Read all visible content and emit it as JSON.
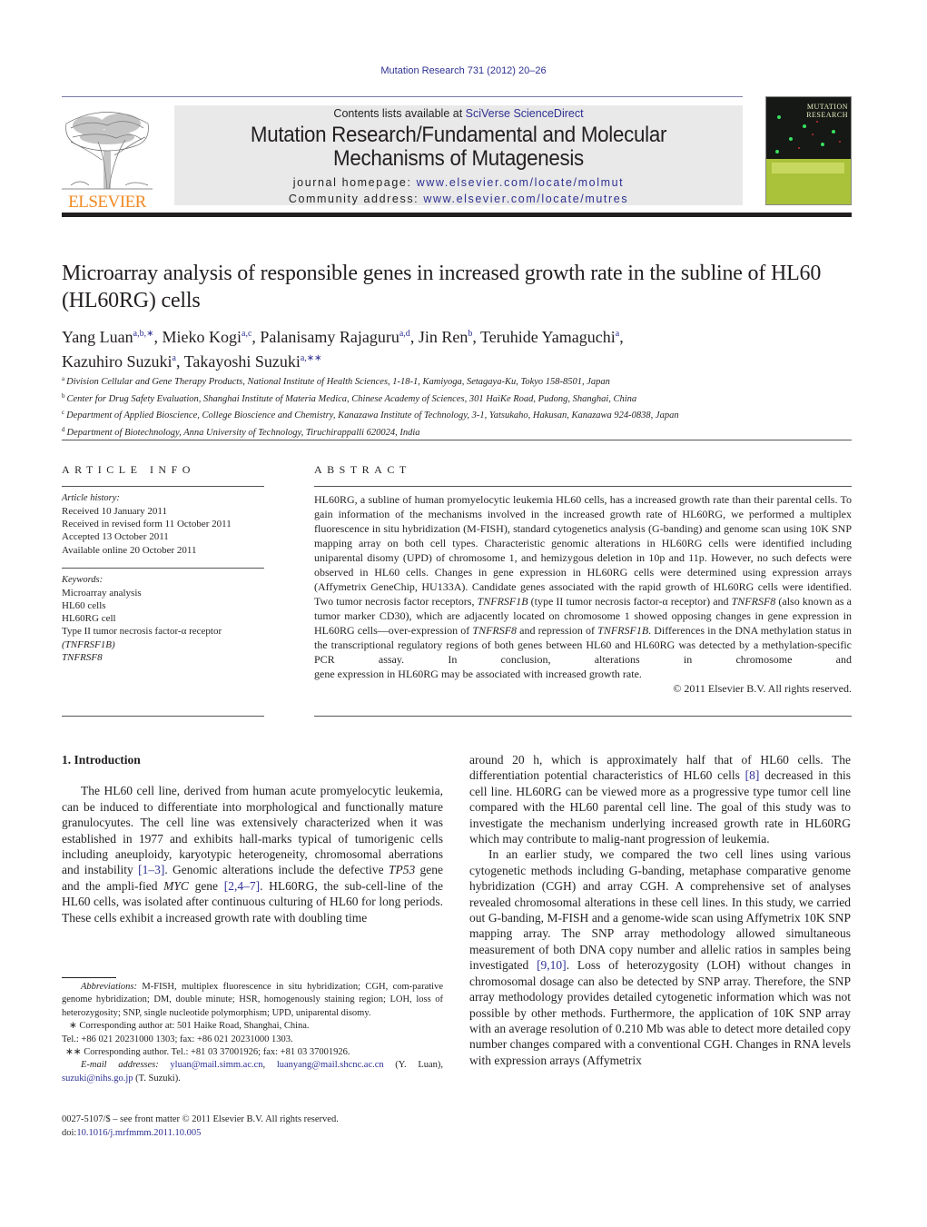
{
  "running_head": "Mutation Research 731 (2012) 20–26",
  "masthead": {
    "publisher": "ELSEVIER",
    "contents_prefix": "Contents lists available at ",
    "contents_link": "SciVerse ScienceDirect",
    "journal_title_line1": "Mutation Research/Fundamental and Molecular",
    "journal_title_line2": "Mechanisms of Mutagenesis",
    "homepage_label": "journal homepage: ",
    "homepage_url": "www.elsevier.com/locate/molmut",
    "community_label": "Community address: ",
    "community_url": "www.elsevier.com/locate/mutres",
    "cover_title_1": "MUTATION",
    "cover_title_2": "RESEARCH"
  },
  "article": {
    "title": "Microarray analysis of responsible genes in increased growth rate in the subline of HL60 (HL60RG) cells",
    "authors": [
      {
        "name": "Yang Luan",
        "sup": "a,b,∗",
        "sep": ", "
      },
      {
        "name": "Mieko Kogi",
        "sup": "a,c",
        "sep": ", "
      },
      {
        "name": "Palanisamy Rajaguru",
        "sup": "a,d",
        "sep": ", "
      },
      {
        "name": "Jin Ren",
        "sup": "b",
        "sep": ", "
      },
      {
        "name": "Teruhide Yamaguchi",
        "sup": "a",
        "sep": ","
      },
      {
        "name": "Kazuhiro Suzuki",
        "sup": "a",
        "sep": ", "
      },
      {
        "name": "Takayoshi Suzuki",
        "sup": "a,∗∗",
        "sep": ""
      }
    ],
    "affiliations": [
      {
        "key": "a",
        "text": "Division Cellular and Gene Therapy Products, National Institute of Health Sciences, 1-18-1, Kamiyoga, Setagaya-Ku, Tokyo 158-8501, Japan"
      },
      {
        "key": "b",
        "text": "Center for Drug Safety Evaluation, Shanghai Institute of Materia Medica, Chinese Academy of Sciences, 301 HaiKe Road, Pudong, Shanghai, China"
      },
      {
        "key": "c",
        "text": "Department of Applied Bioscience, College Bioscience and Chemistry, Kanazawa Institute of Technology, 3-1, Yatsukaho, Hakusan, Kanazawa 924-0838, Japan"
      },
      {
        "key": "d",
        "text": "Department of Biotechnology, Anna University of Technology, Tiruchirappalli 620024, India"
      }
    ]
  },
  "article_info": {
    "heading": "ARTICLE INFO",
    "history_label": "Article history:",
    "history": [
      "Received 10 January 2011",
      "Received in revised form 11 October 2011",
      "Accepted 13 October 2011",
      "Available online 20 October 2011"
    ],
    "keywords_label": "Keywords:",
    "keywords": [
      "Microarray analysis",
      "HL60 cells",
      "HL60RG cell",
      "Type II tumor necrosis factor-α receptor",
      "(TNFRSF1B)",
      "TNFRSF8"
    ]
  },
  "abstract": {
    "heading": "ABSTRACT",
    "text": "HL60RG, a subline of human promyelocytic leukemia HL60 cells, has a increased growth rate than their parental cells. To gain information of the mechanisms involved in the increased growth rate of HL60RG, we performed a multiplex fluorescence in situ hybridization (M-FISH), standard cytogenetics analysis (G-banding) and genome scan using 10K SNP mapping array on both cell types. Characteristic genomic alterations in HL60RG cells were identified including uniparental disomy (UPD) of chromosome 1, and hemizygous deletion in 10p and 11p. However, no such defects were observed in HL60 cells. Changes in gene expression in HL60RG cells were determined using expression arrays (Affymetrix GeneChip, HU133A). Candidate genes associated with the rapid growth of HL60RG cells were identified. Two tumor necrosis factor receptors, TNFRSF1B (type II tumor necrosis factor-α receptor) and TNFRSF8 (also known as a tumor marker CD30), which are adjacently located on chromosome 1 showed opposing changes in gene expression in HL60RG cells—over-expression of TNFRSF8 and repression of TNFRSF1B. Differences in the DNA methylation status in the transcriptional regulatory regions of both genes between HL60 and HL60RG was detected by a methylation-specific PCR assay. In conclusion, alterations in chromosome and",
    "last_line": "gene expression in HL60RG may be associated with increased growth rate.",
    "copyright": "© 2011 Elsevier B.V. All rights reserved."
  },
  "body": {
    "section_heading": "1.  Introduction",
    "left_para": [
      {
        "t": "The HL60 cell line, derived from human acute promyelocytic leukemia, can be induced to differentiate into morphological and functionally mature granulocyutes. The cell line was extensively characterized when it was established in 1977 and exhibits hall-marks typical of tumorigenic cells including aneuploidy, karyotypic heterogeneity, chromosomal aberrations and instability "
      },
      {
        "ref": "[1–3]"
      },
      {
        "t": ". Genomic alterations include the defective "
      },
      {
        "i": "TP53"
      },
      {
        "t": " gene and the ampli-fied "
      },
      {
        "i": "MYC"
      },
      {
        "t": " gene "
      },
      {
        "ref": "[2,4–7]"
      },
      {
        "t": ". HL60RG, the sub-cell-line of the HL60 cells, was isolated after continuous culturing of HL60 for long periods. These cells exhibit a increased growth rate with doubling time"
      }
    ],
    "right_para1": [
      {
        "t": "around 20 h, which is approximately half that of HL60 cells. The differentiation potential characteristics of HL60 cells "
      },
      {
        "ref": "[8]"
      },
      {
        "t": " decreased in this cell line. HL60RG can be viewed more as a progressive type tumor cell line compared with the HL60 parental cell line. The goal of this study was to investigate the mechanism underlying increased growth rate in HL60RG which may contribute to malig-nant progression of leukemia."
      }
    ],
    "right_para2": [
      {
        "t": "In an earlier study, we compared the two cell lines using various cytogenetic methods including G-banding, metaphase comparative genome hybridization (CGH) and array CGH. A comprehensive set of analyses revealed chromosomal alterations in these cell lines. In this study, we carried out G-banding, M-FISH and a genome-wide scan using Affymetrix 10K SNP mapping array. The SNP array methodology allowed simultaneous measurement of both DNA copy number and allelic ratios in samples being investigated "
      },
      {
        "ref": "[9,10]"
      },
      {
        "t": ". Loss of heterozygosity (LOH) without changes in chromosomal dosage can also be detected by SNP array. Therefore, the SNP array methodology provides detailed cytogenetic information which was not possible by other methods. Furthermore, the application of 10K SNP array with an average resolution of 0.210 Mb was able to detect more detailed copy number changes compared with a conventional CGH. Changes in RNA levels with expression arrays (Affymetrix"
      }
    ]
  },
  "footnotes": {
    "abbrev_label": "Abbreviations:",
    "abbrev_text": " M-FISH, multiplex fluorescence in situ hybridization; CGH, com-parative genome hybridization; DM, double minute; HSR, homogenously staining region; LOH, loss of heterozygosity; SNP, single nucleotide polymorphism; UPD, uniparental disomy.",
    "corr1": "∗  Corresponding author at: 501 Haike Road, Shanghai, China.",
    "corr1_tel": "Tel.: +86 021 20231000 1303; fax: +86 021 20231000 1303.",
    "corr2": "∗∗  Corresponding author. Tel.: +81 03 37001926; fax: +81 03 37001926.",
    "email_label": "E-mail addresses:",
    "emails": [
      "yluan@mail.simm.ac.cn",
      "luanyang@mail.shcnc.ac.cn",
      "suzuki@nihs.go.jp"
    ],
    "email_owner1": " (Y. Luan),",
    "email_owner2": " (T. Suzuki)."
  },
  "issn": {
    "line": "0027-5107/$ – see front matter © 2011 Elsevier B.V. All rights reserved.",
    "doi_label": "doi:",
    "doi": "10.1016/j.mrfmmm.2011.10.005"
  },
  "colors": {
    "link": "#2e3192",
    "elsevier_orange": "#f08a24",
    "banner_bg": "#e9e9e9",
    "cover_green": "#a9c23a"
  }
}
